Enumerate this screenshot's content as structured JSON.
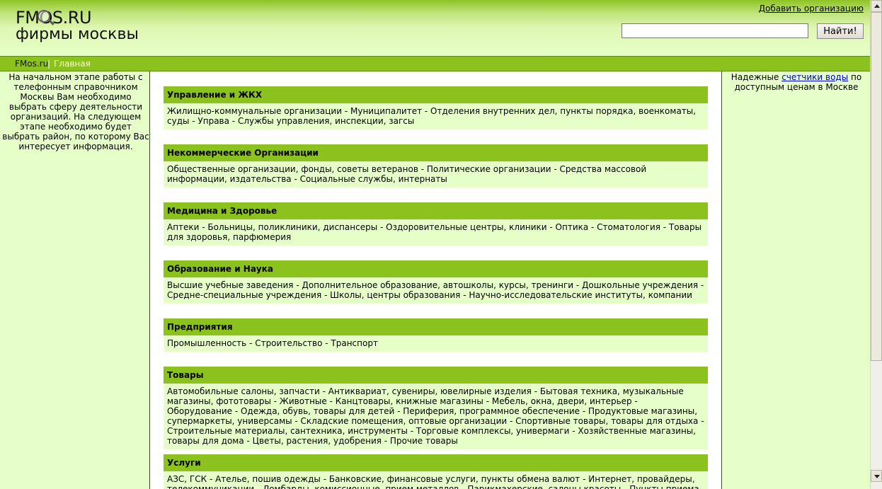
{
  "header": {
    "logo_line1": "FMOS.RU",
    "logo_line2": "фирмы москвы",
    "add_org_link": "Добавить организацию",
    "search_value": "",
    "search_button": "Найти!"
  },
  "nav": {
    "home": "FMos.ru",
    "separator": "|",
    "current": "Главная"
  },
  "left_text": "На начальном этапе работы с телефонным справочником Москвы Вам необходимо выбрать сферу деятельности организаций. На следующем этапе необходимо будет выбрать район, по которому Вас интересует информация.",
  "right_text": {
    "before": "Надежные ",
    "link": "счетчики воды",
    "after": " по доступным ценам в Москве"
  },
  "categories": [
    {
      "title": "Управление и ЖКХ",
      "items": "Жилищно-коммунальные организации - Муниципалитет - Отделения внутренних дел, пункты порядка, военкоматы, суды - Управа - Службы управления, инспекции, загсы"
    },
    {
      "title": "Некоммерческие Организации",
      "items": "Общественные организации, фонды, советы ветеранов - Политические организации - Средства массовой информации, издательства - Социальные службы, интернаты"
    },
    {
      "title": "Медицина и Здоровье",
      "items": "Аптеки - Больницы, поликлиники, диспансеры - Оздоровительные центры, клиники - Оптика - Стоматология - Товары для здоровья, парфюмерия"
    },
    {
      "title": "Образование и Наука",
      "items": "Высшие учебные заведения - Дополнительное образование, автошколы, курсы, тренинги - Дошкольные учреждения - Средне-специальные учреждения - Школы, центры образования - Научно-исследовательские институты, компании"
    },
    {
      "title": "Предприятия",
      "items": "Промышленность - Строительство - Транспорт"
    },
    {
      "title": "Товары",
      "items": "Автомобильные салоны, запчасти - Антиквариат, сувениры, ювелирные изделия - Бытовая техника, музыкальные магазины, фототовары - Животные - Канцтовары, книжные магазины - Мебель, окна, двери, интерьер - Оборудование - Одежда, обувь, товары для детей - Периферия, программное обеспечение - Продуктовые магазины, супермаркеты, универсамы - Складские помещения, оптовые организации - Спортивные товары, товары для отдыха - Строительные материалы, сантехника, инструменты - Торговые комплексы, универмаги - Хозяйственные магазины, товары для дома - Цветы, растения, удобрения - Прочие товары"
    },
    {
      "title": "Услуги",
      "items": "АЗС, ГСК - Ателье, пошив одежды - Банковские, финансовые услуги, пункты обмена валют - Интернет, провайдеры, телекоммуникации - Ломбарды, комиссионные, прием металлов - Парикмахерские, салоны красоты - Пункты приема платежей"
    }
  ],
  "colors": {
    "accent_green": "#8cc21e",
    "page_bg": "#e6ffc8",
    "link_blue": "#0000cc"
  }
}
